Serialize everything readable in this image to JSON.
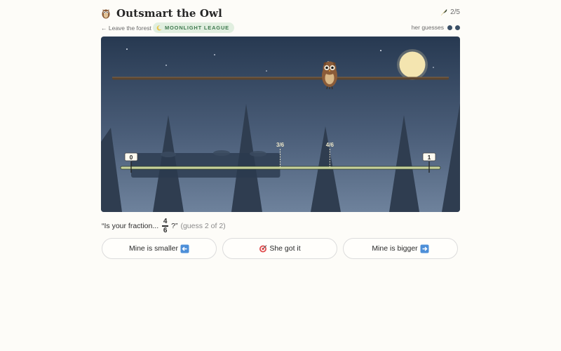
{
  "header": {
    "title": "Outsmart the Owl",
    "icon": "owl-icon",
    "score_icon": "feather-icon",
    "score": "2/5"
  },
  "subbar": {
    "leave_label": "← Leave the forest",
    "league_icon": "moon-icon",
    "league_label": "MOONLIGHT LEAGUE",
    "guesses_label": "her guesses",
    "guess_count": 2
  },
  "scene": {
    "left_label": "0",
    "right_label": "1",
    "markers": [
      {
        "label": "3/6",
        "value": 0.5
      },
      {
        "label": "4/6",
        "value": 0.6667
      }
    ],
    "shaded_range": [
      0,
      0.5
    ],
    "owl_icon": "owl-icon",
    "moon_icon": "moon-icon",
    "colors": {
      "sky_top": "#283a53",
      "sky_bottom": "#697d97",
      "tree": "#2f3d50",
      "branch": "#5a4530",
      "line_fill": "#c7d39a",
      "moon": "#f4e5b0"
    }
  },
  "question": {
    "prefix": "“Is your fraction...",
    "numerator": "4",
    "denominator": "6",
    "suffix": "?”",
    "guess_note": "(guess 2 of 2)"
  },
  "buttons": {
    "smaller": {
      "label": "Mine is smaller",
      "icon": "left-arrow-icon"
    },
    "got_it": {
      "label": "She got it",
      "icon": "target-icon"
    },
    "bigger": {
      "label": "Mine is bigger",
      "icon": "right-arrow-icon"
    }
  }
}
